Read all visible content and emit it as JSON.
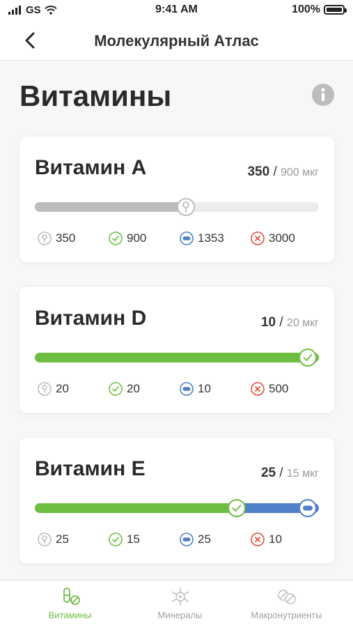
{
  "status": {
    "carrier": "GS",
    "time": "9:41 AM",
    "battery": "100%"
  },
  "nav": {
    "title": "Молекулярный Атлас",
    "back_icon": "chevron-left-icon"
  },
  "page": {
    "title": "Витамины",
    "info_icon": "info-icon"
  },
  "colors": {
    "green": "#6fbe44",
    "blue": "#4f80c8",
    "red": "#e14a3b",
    "gray": "#bdbdbd"
  },
  "vitamins": [
    {
      "name": "Витамин A",
      "value": "350",
      "sep": "/",
      "target": "900 мкг",
      "progress_fraction": 0.5,
      "stats": {
        "min": "350",
        "norm": "900",
        "avg": "1353",
        "max": "3000"
      }
    },
    {
      "name": "Витамин D",
      "value": "10",
      "sep": "/",
      "target": "20 мкг",
      "progress_fraction": 1.0,
      "stats": {
        "min": "20",
        "norm": "20",
        "avg": "10",
        "max": "500"
      }
    },
    {
      "name": "Витамин E",
      "value": "25",
      "sep": "/",
      "target": "15 мкг",
      "progress_fraction": 1.0,
      "norm_fraction": 0.71,
      "stats": {
        "min": "25",
        "norm": "15",
        "avg": "25",
        "max": "10"
      }
    }
  ],
  "tabs": [
    {
      "label": "Витамины",
      "icon": "pill-icon",
      "active": true
    },
    {
      "label": "Минералы",
      "icon": "molecule-icon",
      "active": false
    },
    {
      "label": "Макронутриенты",
      "icon": "macronutrients-icon",
      "active": false
    }
  ]
}
